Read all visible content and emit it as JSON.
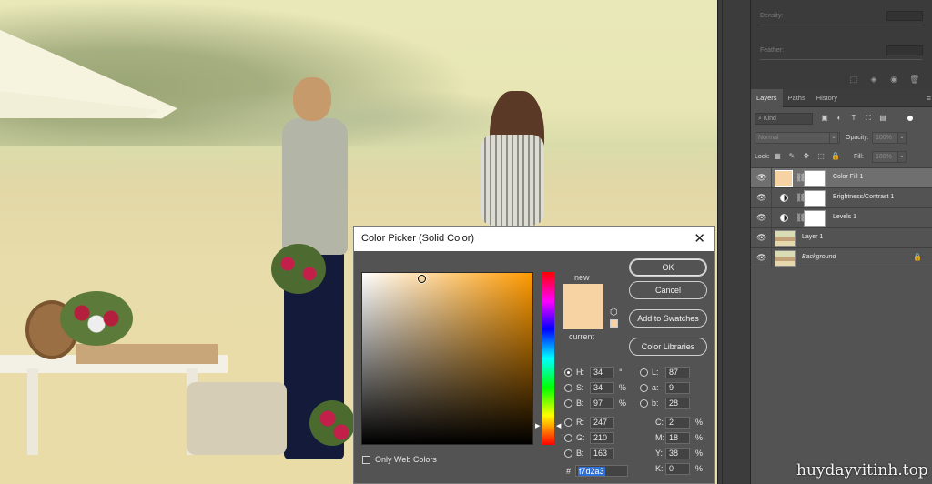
{
  "dialog": {
    "title": "Color Picker (Solid Color)",
    "close_glyph": "✕",
    "new_label": "new",
    "current_label": "current",
    "buttons": {
      "ok": "OK",
      "cancel": "Cancel",
      "add_to_swatches": "Add to Swatches",
      "color_libraries": "Color Libraries"
    },
    "fields": {
      "H": {
        "label": "H:",
        "value": "34",
        "unit": "°"
      },
      "S": {
        "label": "S:",
        "value": "34",
        "unit": "%"
      },
      "B": {
        "label": "B:",
        "value": "97",
        "unit": "%"
      },
      "R": {
        "label": "R:",
        "value": "247"
      },
      "G": {
        "label": "G:",
        "value": "210"
      },
      "Bv": {
        "label": "B:",
        "value": "163"
      },
      "L": {
        "label": "L:",
        "value": "87"
      },
      "a": {
        "label": "a:",
        "value": "9"
      },
      "b": {
        "label": "b:",
        "value": "28"
      },
      "C": {
        "label": "C:",
        "value": "2",
        "unit": "%"
      },
      "M": {
        "label": "M:",
        "value": "18",
        "unit": "%"
      },
      "Y": {
        "label": "Y:",
        "value": "38",
        "unit": "%"
      },
      "K": {
        "label": "K:",
        "value": "0",
        "unit": "%"
      }
    },
    "only_web_colors": "Only Web Colors",
    "hex_hash": "#",
    "hex": "f7d2a3",
    "selected_color": "#f7d2a3",
    "selected_radio": "H"
  },
  "properties": {
    "density_label": "Density:",
    "feather_label": "Feather:"
  },
  "layers_panel": {
    "tabs": [
      "Layers",
      "Paths",
      "History"
    ],
    "filter_kind": "Kind",
    "blend_mode": "Normal",
    "opacity_label": "Opacity:",
    "opacity_value": "100%",
    "lock_label": "Lock:",
    "fill_label": "Fill:",
    "fill_value": "100%",
    "layers": [
      {
        "name": "Color Fill 1",
        "type": "fill",
        "selected": true
      },
      {
        "name": "Brightness/Contrast 1",
        "type": "adjustment"
      },
      {
        "name": "Levels 1",
        "type": "adjustment"
      },
      {
        "name": "Layer 1",
        "type": "pixel"
      },
      {
        "name": "Background",
        "type": "background",
        "locked": true
      }
    ]
  },
  "watermark": "huydayvitinh.top"
}
